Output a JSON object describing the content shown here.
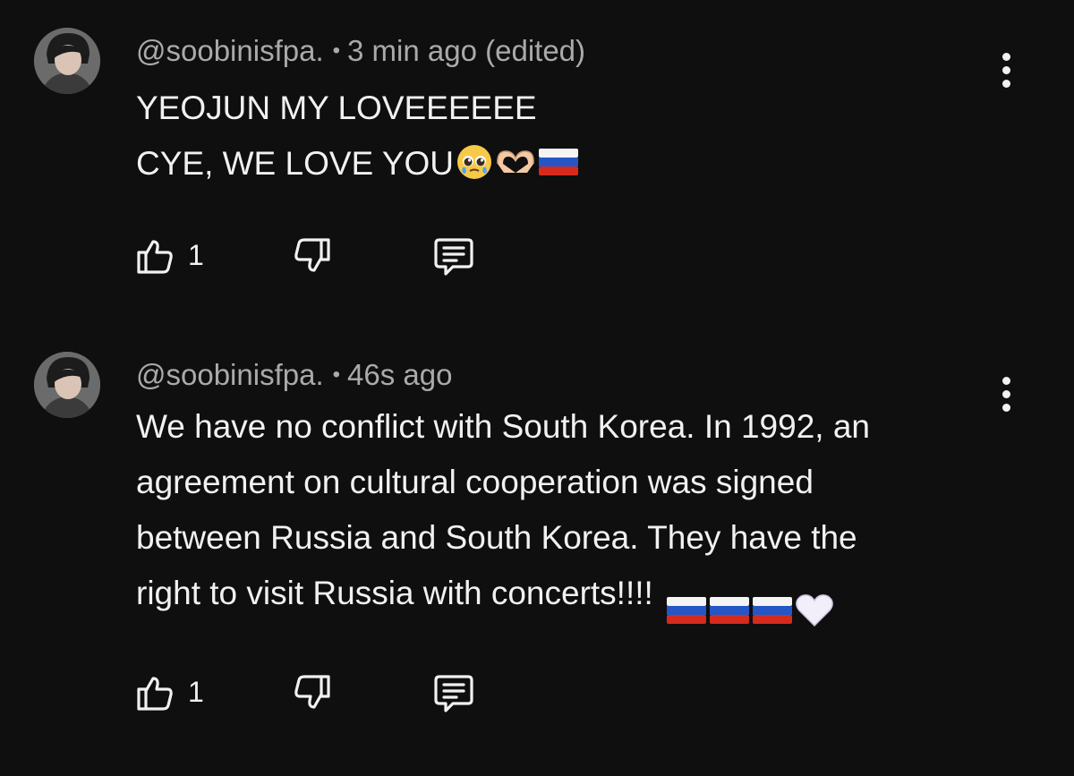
{
  "comments": [
    {
      "author": "@soobinisfpa.",
      "separator": "•",
      "time": "3 min ago (edited)",
      "lines": [
        "YEOJUN MY LOVEEEEEE",
        "CYE, WE LOVE YOU"
      ],
      "emojis": [
        "pleading-face",
        "heart-hands",
        "russia-flag"
      ],
      "likes": "1"
    },
    {
      "author": "@soobinisfpa.",
      "separator": "•",
      "time": "46s ago",
      "lines": [
        "We have no conflict with South Korea. In 1992, an",
        "agreement on cultural cooperation was signed",
        "between Russia and South Korea. They have the",
        "right to visit Russia with concerts!!!!"
      ],
      "emojis": [
        "russia-flag",
        "russia-flag",
        "russia-flag",
        "white-heart"
      ],
      "likes": "1"
    }
  ],
  "icons": {
    "like": "thumbs-up-icon",
    "dislike": "thumbs-down-icon",
    "reply": "reply-icon",
    "more": "more-vert-icon"
  },
  "colors": {
    "background": "#0f0f0f",
    "text": "#f1f1f1",
    "meta": "#aaaaaa"
  }
}
